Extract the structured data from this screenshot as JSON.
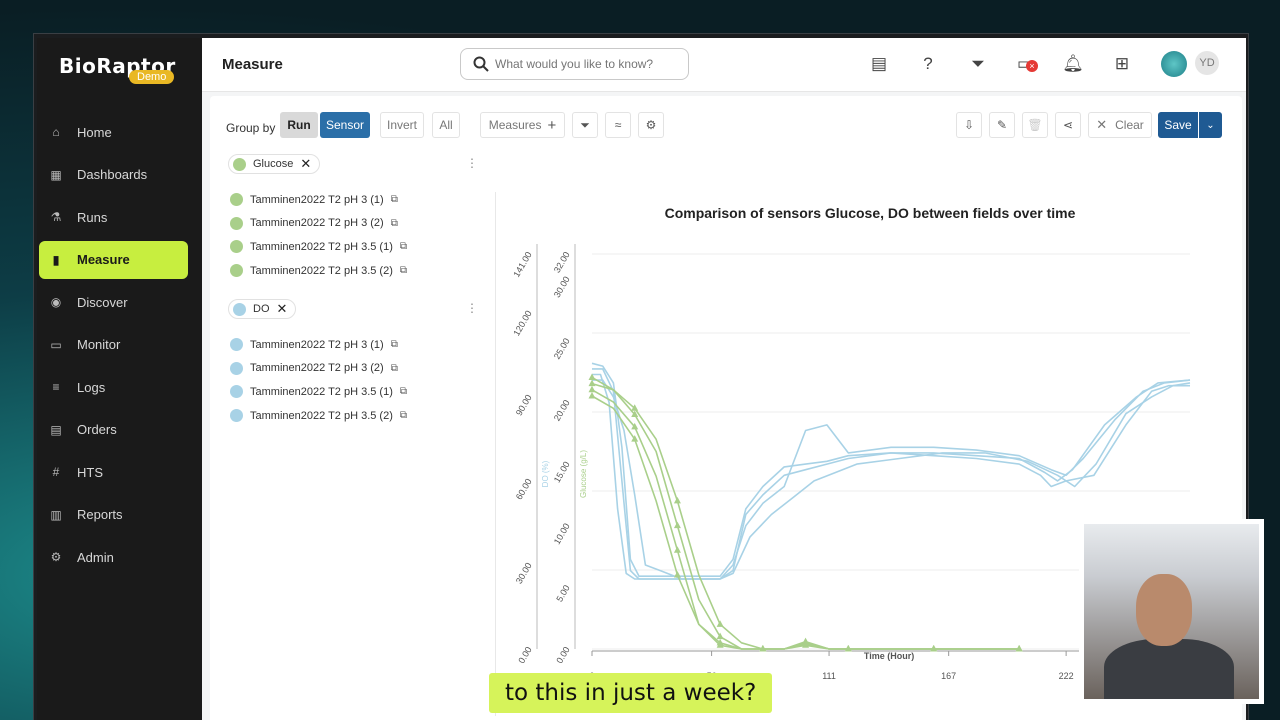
{
  "brand": {
    "name": "BioRaptor",
    "badge": "Demo"
  },
  "sidebar": {
    "items": [
      {
        "label": "Home",
        "icon": "home-icon"
      },
      {
        "label": "Dashboards",
        "icon": "dashboard-icon"
      },
      {
        "label": "Runs",
        "icon": "flask-icon"
      },
      {
        "label": "Measure",
        "icon": "bar-chart-icon",
        "active": true
      },
      {
        "label": "Discover",
        "icon": "eye-icon"
      },
      {
        "label": "Monitor",
        "icon": "monitor-icon"
      },
      {
        "label": "Logs",
        "icon": "list-icon"
      },
      {
        "label": "Orders",
        "icon": "document-icon"
      },
      {
        "label": "HTS",
        "icon": "hts-icon"
      },
      {
        "label": "Reports",
        "icon": "report-icon"
      },
      {
        "label": "Admin",
        "icon": "gear-icon"
      }
    ]
  },
  "header": {
    "title": "Measure",
    "search_placeholder": "What would you like to know?",
    "avatar_initials": "YD"
  },
  "toolbar": {
    "group_by_label": "Group by",
    "run_label": "Run",
    "sensor_label": "Sensor",
    "invert_label": "Invert",
    "all_label": "All",
    "measures_label": "Measures",
    "clear_label": "Clear",
    "save_label": "Save"
  },
  "sensor_groups": [
    {
      "name": "Glucose",
      "color": "#a9cf8a",
      "series": [
        "Tamminen2022 T2 pH 3 (1)",
        "Tamminen2022 T2 pH 3 (2)",
        "Tamminen2022 T2 pH 3.5 (1)",
        "Tamminen2022 T2 pH 3.5 (2)"
      ]
    },
    {
      "name": "DO",
      "color": "#a8d2e6",
      "series": [
        "Tamminen2022 T2 pH 3 (1)",
        "Tamminen2022 T2 pH 3 (2)",
        "Tamminen2022 T2 pH 3.5 (1)",
        "Tamminen2022 T2 pH 3.5 (2)"
      ]
    }
  ],
  "chart_data": {
    "type": "line",
    "title": "Comparison of sensors Glucose, DO between fields over time",
    "xlabel": "Time (Hour)",
    "x_ticks": [
      "0",
      "56",
      "111",
      "167",
      "222"
    ],
    "xlim": [
      0,
      280
    ],
    "y_axes": [
      {
        "label": "DO (%)",
        "ticks": [
          "0.00",
          "30.00",
          "60.00",
          "90.00",
          "120.00",
          "141.00"
        ],
        "ylim": [
          0,
          141
        ],
        "color": "#a8d2e6"
      },
      {
        "label": "Glucose (g/L)",
        "ticks": [
          "0.00",
          "5.00",
          "10.00",
          "15.00",
          "20.00",
          "25.00",
          "30.00",
          "32.00"
        ],
        "ylim": [
          0,
          32
        ],
        "color": "#a9cf8a"
      }
    ],
    "series": [
      {
        "sensor": "DO",
        "name": "Tamminen2022 T2 pH 3 (1)",
        "color": "#a8d2e6",
        "x": [
          0,
          5,
          10,
          14,
          18,
          22,
          30,
          40,
          50,
          60,
          66,
          72,
          80,
          90,
          100,
          110,
          120,
          140,
          160,
          180,
          200,
          210,
          215,
          222,
          235,
          250,
          262,
          270,
          280
        ],
        "y": [
          100,
          100,
          92,
          60,
          28,
          25,
          25,
          25,
          25,
          25,
          28,
          48,
          55,
          62,
          64,
          66,
          68,
          70,
          69,
          68,
          66,
          62,
          58,
          60,
          62,
          80,
          92,
          94,
          94
        ]
      },
      {
        "sensor": "DO",
        "name": "Tamminen2022 T2 pH 3 (2)",
        "color": "#a8d2e6",
        "x": [
          0,
          5,
          10,
          14,
          18,
          22,
          30,
          40,
          50,
          60,
          66,
          72,
          80,
          90,
          100,
          110,
          120,
          140,
          160,
          180,
          200,
          212,
          218,
          225,
          240,
          255,
          265,
          280
        ],
        "y": [
          102,
          101,
          95,
          72,
          32,
          26,
          26,
          26,
          26,
          26,
          32,
          50,
          58,
          65,
          66,
          67,
          69,
          70,
          70,
          69,
          68,
          63,
          60,
          64,
          80,
          90,
          95,
          96
        ]
      },
      {
        "sensor": "DO",
        "name": "Tamminen2022 T2 pH 3.5 (1)",
        "color": "#a8d2e6",
        "x": [
          0,
          4,
          8,
          12,
          16,
          20,
          30,
          40,
          50,
          60,
          66,
          72,
          80,
          90,
          100,
          110,
          120,
          140,
          160,
          180,
          200,
          215,
          222,
          230,
          245,
          258,
          268,
          280
        ],
        "y": [
          98,
          98,
          88,
          50,
          27,
          25,
          25,
          25,
          25,
          25,
          30,
          44,
          52,
          58,
          78,
          80,
          70,
          72,
          72,
          71,
          69,
          64,
          62,
          68,
          82,
          92,
          95,
          96
        ]
      },
      {
        "sensor": "DO",
        "name": "Tamminen2022 T2 pH 3.5 (2)",
        "color": "#a8d2e6",
        "x": [
          0,
          5,
          10,
          15,
          20,
          25,
          32,
          42,
          52,
          60,
          66,
          74,
          84,
          94,
          104,
          114,
          124,
          144,
          164,
          184,
          204,
          218,
          226,
          236,
          250,
          262,
          272,
          280
        ],
        "y": [
          96,
          96,
          90,
          78,
          55,
          30,
          28,
          25,
          25,
          25,
          27,
          40,
          48,
          54,
          60,
          63,
          66,
          68,
          70,
          70,
          67,
          62,
          58,
          66,
          84,
          90,
          94,
          95
        ]
      },
      {
        "sensor": "Glucose",
        "name": "Tamminen2022 T2 pH 3 (1)",
        "color": "#a9cf8a",
        "x": [
          0,
          10,
          20,
          30,
          40,
          50,
          60,
          70,
          80,
          90,
          100,
          111,
          120,
          140,
          160,
          180,
          200
        ],
        "y": [
          21,
          20,
          18,
          14,
          8,
          2,
          0.5,
          0,
          0,
          0,
          0.5,
          0,
          0,
          0,
          0,
          0,
          0
        ]
      },
      {
        "sensor": "Glucose",
        "name": "Tamminen2022 T2 pH 3 (2)",
        "color": "#a9cf8a",
        "x": [
          0,
          10,
          20,
          30,
          40,
          50,
          60,
          70,
          80,
          90,
          100,
          111,
          120,
          140,
          160,
          180,
          200
        ],
        "y": [
          21.5,
          21,
          19,
          16,
          10,
          4,
          1,
          0,
          0,
          0,
          0.3,
          0,
          0,
          0,
          0,
          0,
          0
        ]
      },
      {
        "sensor": "Glucose",
        "name": "Tamminen2022 T2 pH 3.5 (1)",
        "color": "#a9cf8a",
        "x": [
          0,
          10,
          20,
          30,
          40,
          50,
          60,
          70,
          80,
          90,
          100,
          111,
          120,
          140,
          160,
          180,
          200
        ],
        "y": [
          20.5,
          19.5,
          17,
          12,
          6,
          2,
          0.3,
          0,
          0,
          0,
          0.6,
          0,
          0,
          0,
          0,
          0,
          0
        ]
      },
      {
        "sensor": "Glucose",
        "name": "Tamminen2022 T2 pH 3.5 (2)",
        "color": "#a9cf8a",
        "x": [
          0,
          10,
          20,
          30,
          40,
          50,
          60,
          70,
          80,
          90,
          100,
          111,
          120,
          140,
          160,
          180,
          200
        ],
        "y": [
          22,
          21,
          19.5,
          17,
          12,
          6,
          2,
          0.5,
          0,
          0,
          0.4,
          0,
          0,
          0,
          0,
          0,
          0
        ]
      }
    ]
  },
  "caption": "to this in just a week?"
}
